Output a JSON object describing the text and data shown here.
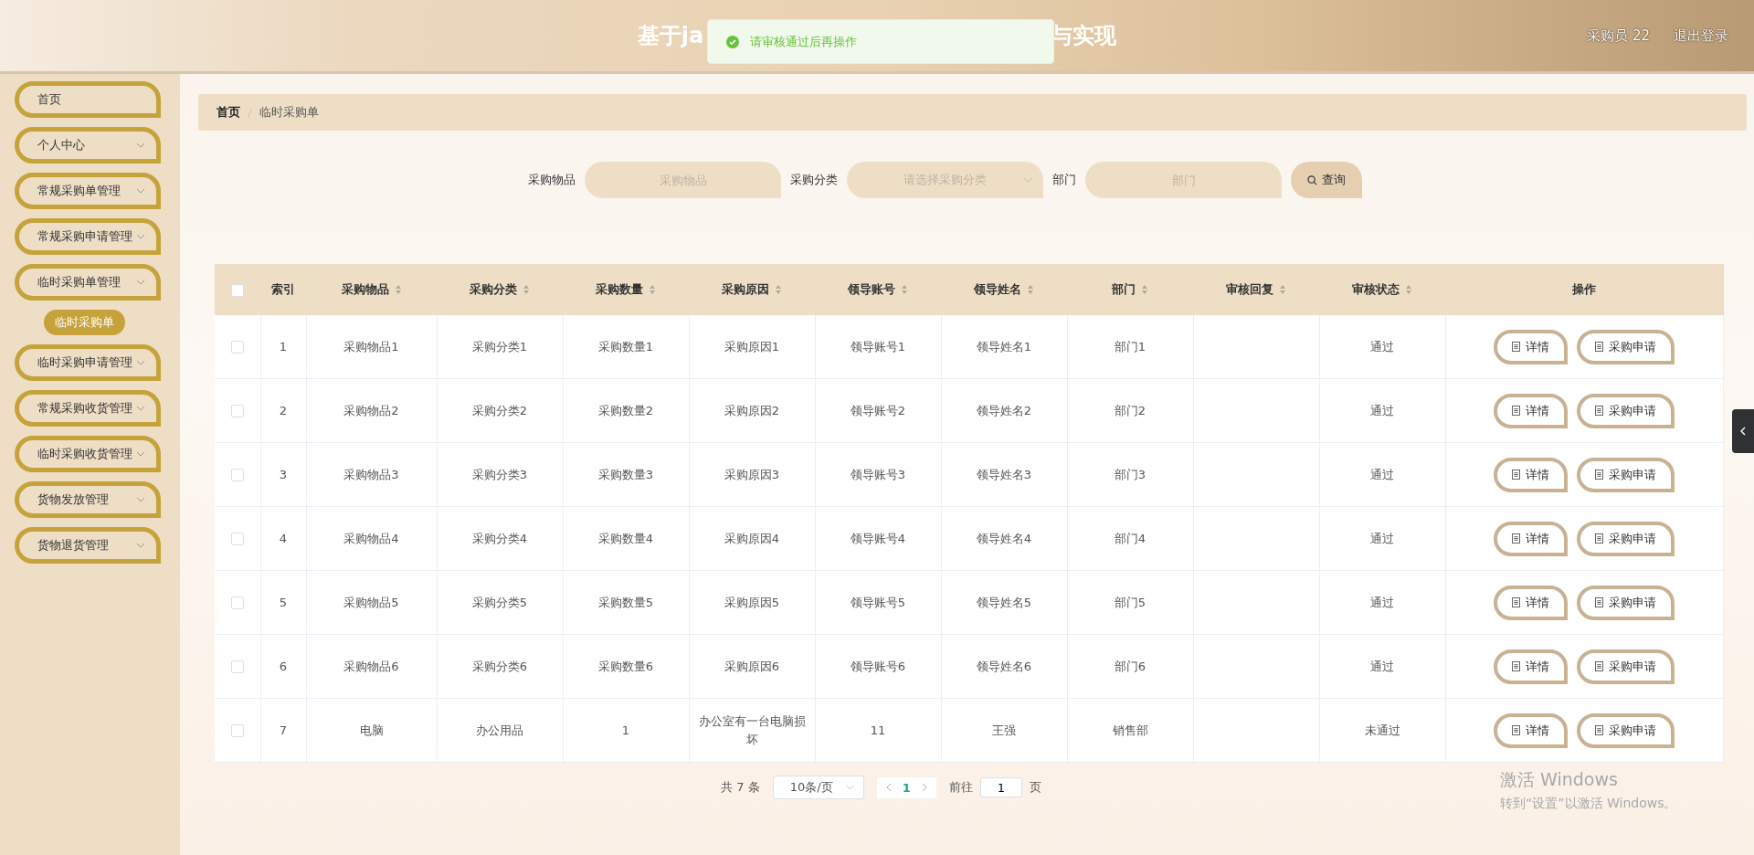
{
  "header": {
    "title_start": "基于ja",
    "title_end": "与实现",
    "user": "采购员 22",
    "logout": "退出登录"
  },
  "toast": {
    "message": "请审核通过后再操作"
  },
  "sidebar": {
    "items": [
      {
        "label": "首页",
        "expandable": false
      },
      {
        "label": "个人中心",
        "expandable": true
      },
      {
        "label": "常规采购单管理",
        "expandable": true
      },
      {
        "label": "常规采购申请管理",
        "expandable": true
      },
      {
        "label": "临时采购单管理",
        "expandable": true,
        "children": [
          {
            "label": "临时采购单",
            "selected": true
          }
        ]
      },
      {
        "label": "临时采购申请管理",
        "expandable": true
      },
      {
        "label": "常规采购收货管理",
        "expandable": true
      },
      {
        "label": "临时采购收货管理",
        "expandable": true
      },
      {
        "label": "货物发放管理",
        "expandable": true
      },
      {
        "label": "货物退货管理",
        "expandable": true
      }
    ]
  },
  "breadcrumb": [
    "首页",
    "临时采购单"
  ],
  "search": {
    "fields": [
      {
        "kind": "input",
        "label": "采购物品",
        "placeholder": "采购物品"
      },
      {
        "kind": "select",
        "label": "采购分类",
        "placeholder": "请选择采购分类"
      },
      {
        "kind": "input",
        "label": "部门",
        "placeholder": "部门"
      }
    ],
    "button": "查询"
  },
  "table": {
    "all_checked": false,
    "columns": [
      {
        "label": "索引",
        "sortable": false
      },
      {
        "label": "采购物品",
        "sortable": true
      },
      {
        "label": "采购分类",
        "sortable": true
      },
      {
        "label": "采购数量",
        "sortable": true
      },
      {
        "label": "采购原因",
        "sortable": true
      },
      {
        "label": "领导账号",
        "sortable": true
      },
      {
        "label": "领导姓名",
        "sortable": true
      },
      {
        "label": "部门",
        "sortable": true
      },
      {
        "label": "审核回复",
        "sortable": true
      },
      {
        "label": "审核状态",
        "sortable": true
      },
      {
        "label": "操作",
        "sortable": false
      }
    ],
    "rows": [
      {
        "checked": false,
        "cells": [
          "1",
          "采购物品1",
          "采购分类1",
          "采购数量1",
          "采购原因1",
          "领导账号1",
          "领导姓名1",
          "部门1",
          "",
          "通过"
        ],
        "actions": [
          "详情",
          "采购申请"
        ]
      },
      {
        "checked": false,
        "cells": [
          "2",
          "采购物品2",
          "采购分类2",
          "采购数量2",
          "采购原因2",
          "领导账号2",
          "领导姓名2",
          "部门2",
          "",
          "通过"
        ],
        "actions": [
          "详情",
          "采购申请"
        ]
      },
      {
        "checked": false,
        "cells": [
          "3",
          "采购物品3",
          "采购分类3",
          "采购数量3",
          "采购原因3",
          "领导账号3",
          "领导姓名3",
          "部门3",
          "",
          "通过"
        ],
        "actions": [
          "详情",
          "采购申请"
        ]
      },
      {
        "checked": false,
        "cells": [
          "4",
          "采购物品4",
          "采购分类4",
          "采购数量4",
          "采购原因4",
          "领导账号4",
          "领导姓名4",
          "部门4",
          "",
          "通过"
        ],
        "actions": [
          "详情",
          "采购申请"
        ]
      },
      {
        "checked": false,
        "cells": [
          "5",
          "采购物品5",
          "采购分类5",
          "采购数量5",
          "采购原因5",
          "领导账号5",
          "领导姓名5",
          "部门5",
          "",
          "通过"
        ],
        "actions": [
          "详情",
          "采购申请"
        ]
      },
      {
        "checked": false,
        "cells": [
          "6",
          "采购物品6",
          "采购分类6",
          "采购数量6",
          "采购原因6",
          "领导账号6",
          "领导姓名6",
          "部门6",
          "",
          "通过"
        ],
        "actions": [
          "详情",
          "采购申请"
        ]
      },
      {
        "checked": false,
        "cells": [
          "7",
          "电脑",
          "办公用品",
          "1",
          "办公室有一台电脑损坏",
          "11",
          "王强",
          "销售部",
          "",
          "未通过"
        ],
        "actions": [
          "详情",
          "采购申请"
        ]
      }
    ]
  },
  "pagination": {
    "total": "共 7 条",
    "page_size": "10条/页",
    "pages": [
      {
        "label": "1",
        "selected": true
      }
    ],
    "goto_label": "前往",
    "goto_value": "1",
    "goto_unit": "页"
  },
  "os_notice": {
    "title": "激活 Windows",
    "text": "转到“设置”以激活 Windows。"
  }
}
